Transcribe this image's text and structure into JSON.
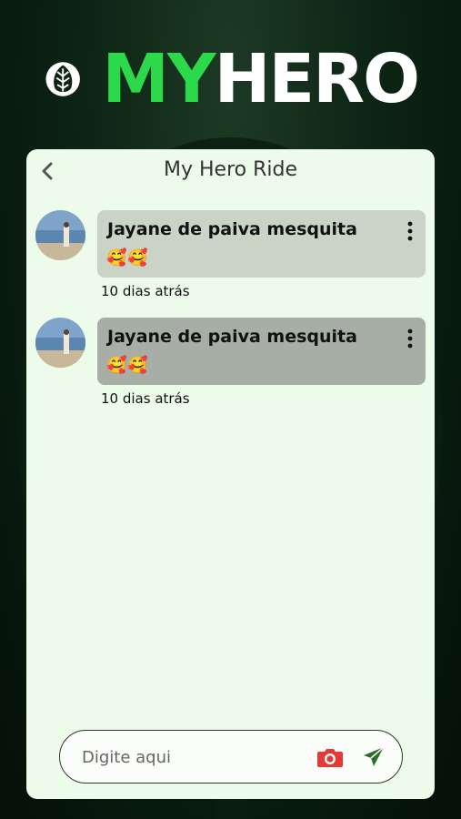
{
  "brand": {
    "part1": "MY",
    "part2": "HERO",
    "accent": "#2bd94a"
  },
  "header": {
    "title": "My Hero Ride",
    "back_icon": "chevron-left-icon"
  },
  "messages": [
    {
      "author": "Jayane de paiva mesquita",
      "text": "🥰🥰",
      "time": "10 dias atrás",
      "bubble_color": "#c9d3c6"
    },
    {
      "author": "Jayane de paiva mesquita",
      "text": "🥰🥰",
      "time": "10 dias atrás",
      "bubble_color": "#a7aea5"
    }
  ],
  "composer": {
    "placeholder": "Digite aqui",
    "camera_icon": "camera-icon",
    "send_icon": "send-icon",
    "camera_color": "#e53935",
    "send_color": "#2e6b2a"
  }
}
